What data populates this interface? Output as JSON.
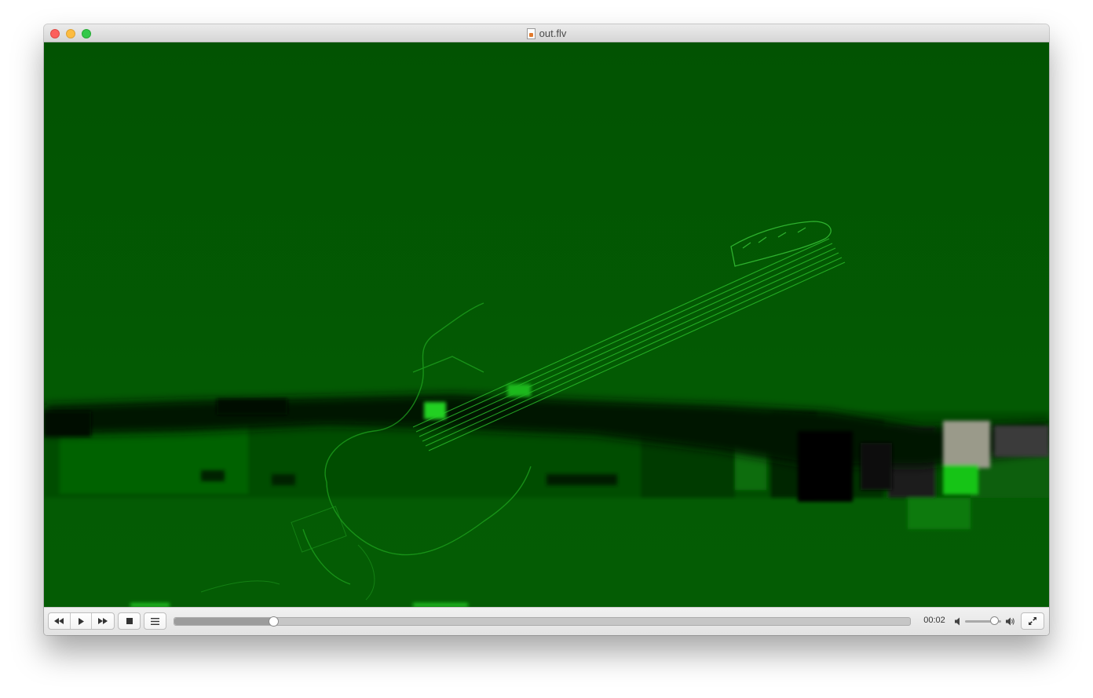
{
  "window": {
    "title": "out.flv",
    "file_icon": "flv-document-icon"
  },
  "titlebar": {
    "buttons": [
      "close",
      "minimize",
      "zoom"
    ]
  },
  "video": {
    "description_colors": {
      "background": "#035903",
      "highlight": "#1fd41f",
      "dark_band": "#011a01"
    }
  },
  "controls": {
    "rewind_icon": "rewind-icon",
    "play_icon": "play-icon",
    "fast_forward_icon": "fast-forward-icon",
    "stop_icon": "stop-icon",
    "playlist_icon": "playlist-icon",
    "seek_progress": 0.135,
    "time": "00:02",
    "volume_level": 0.8,
    "volume_low_icon": "volume-low-icon",
    "volume_high_icon": "volume-high-icon",
    "fullscreen_icon": "fullscreen-icon"
  }
}
